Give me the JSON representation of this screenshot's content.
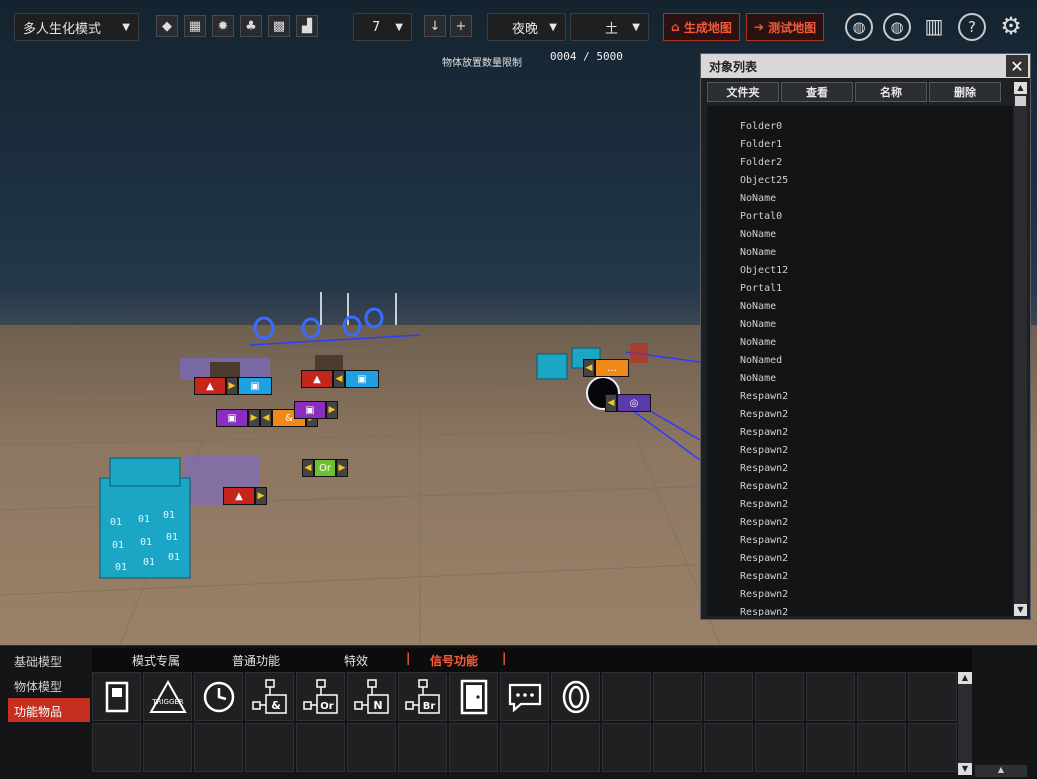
{
  "toolbar": {
    "mode_label": "多人生化模式",
    "number_select": "7",
    "time_select": "夜晚",
    "terrain_select": "土",
    "generate_map_label": "生成地图",
    "test_map_label": "测试地图"
  },
  "hud": {
    "object_limit_label": "物体放置数量限制",
    "object_limit_value": "0004 / 5000"
  },
  "object_panel": {
    "title": "对象列表",
    "tabs": [
      "文件夹",
      "查看",
      "名称",
      "删除"
    ],
    "items": [
      "Folder0",
      "Folder1",
      "Folder2",
      "Object25",
      "NoName",
      "Portal0",
      "NoName",
      "NoName",
      "Object12",
      "Portal1",
      "NoName",
      "NoName",
      "NoName",
      "NoNamed",
      "NoName",
      "Respawn2",
      "Respawn2",
      "Respawn2",
      "Respawn2",
      "Respawn2",
      "Respawn2",
      "Respawn2",
      "Respawn2",
      "Respawn2",
      "Respawn2",
      "Respawn2",
      "Respawn2",
      "Respawn2"
    ]
  },
  "bottom": {
    "categories": [
      "基础模型",
      "物体模型",
      "功能物品"
    ],
    "active_category": "功能物品",
    "subtabs": [
      "模式专属",
      "普通功能",
      "特效",
      "信号功能"
    ],
    "active_subtab": "信号功能",
    "items": [
      "switch-icon",
      "trigger-icon",
      "timer-icon",
      "and-gate-icon",
      "or-gate-icon",
      "not-gate-icon",
      "branch-gate-icon",
      "door-icon",
      "message-icon",
      "portal-icon"
    ],
    "trigger_text": "TRIGGER",
    "gate_labels": [
      "&",
      "Or",
      "N",
      "Br"
    ]
  },
  "scene": {
    "or_label": "Or",
    "and_label": "&"
  }
}
